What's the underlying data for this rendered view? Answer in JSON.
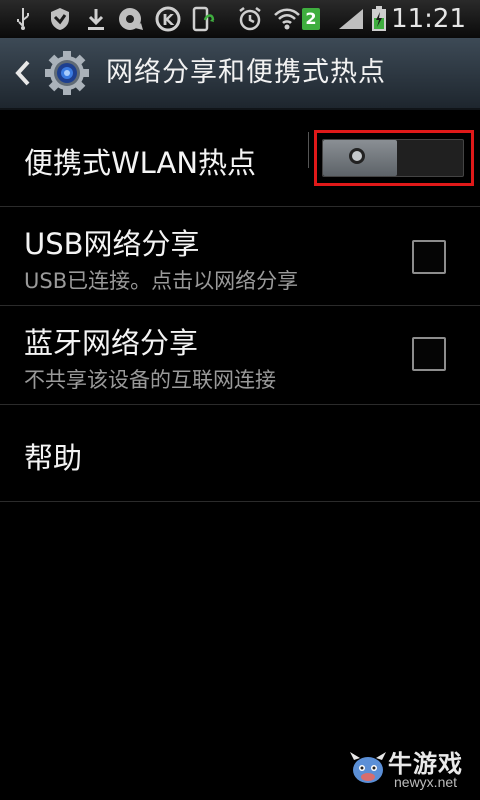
{
  "status_bar": {
    "time": "11:21",
    "notification_badge": "2",
    "icons": [
      "usb-icon",
      "shield-icon",
      "download-icon",
      "disc-icon",
      "k-app-icon",
      "phone-update-icon",
      "alarm-icon",
      "wifi-icon",
      "signal-icon",
      "battery-charging-icon"
    ],
    "accent_badge": "#3fae3f"
  },
  "action_bar": {
    "title": "网络分享和便携式热点",
    "back_icon": "chevron-left-icon",
    "app_icon": "settings-gear-icon"
  },
  "settings": {
    "wlan_hotspot": {
      "label": "便携式WLAN热点",
      "enabled": false,
      "highlight_color": "#e01919"
    },
    "usb_tethering": {
      "label": "USB网络分享",
      "summary": "USB已连接。点击以网络分享",
      "checked": false
    },
    "bluetooth_tethering": {
      "label": "蓝牙网络分享",
      "summary": "不共享该设备的互联网连接",
      "checked": false
    },
    "help": {
      "label": "帮助"
    }
  },
  "watermark": {
    "text": "牛游戏",
    "sub": "newyx.net"
  }
}
